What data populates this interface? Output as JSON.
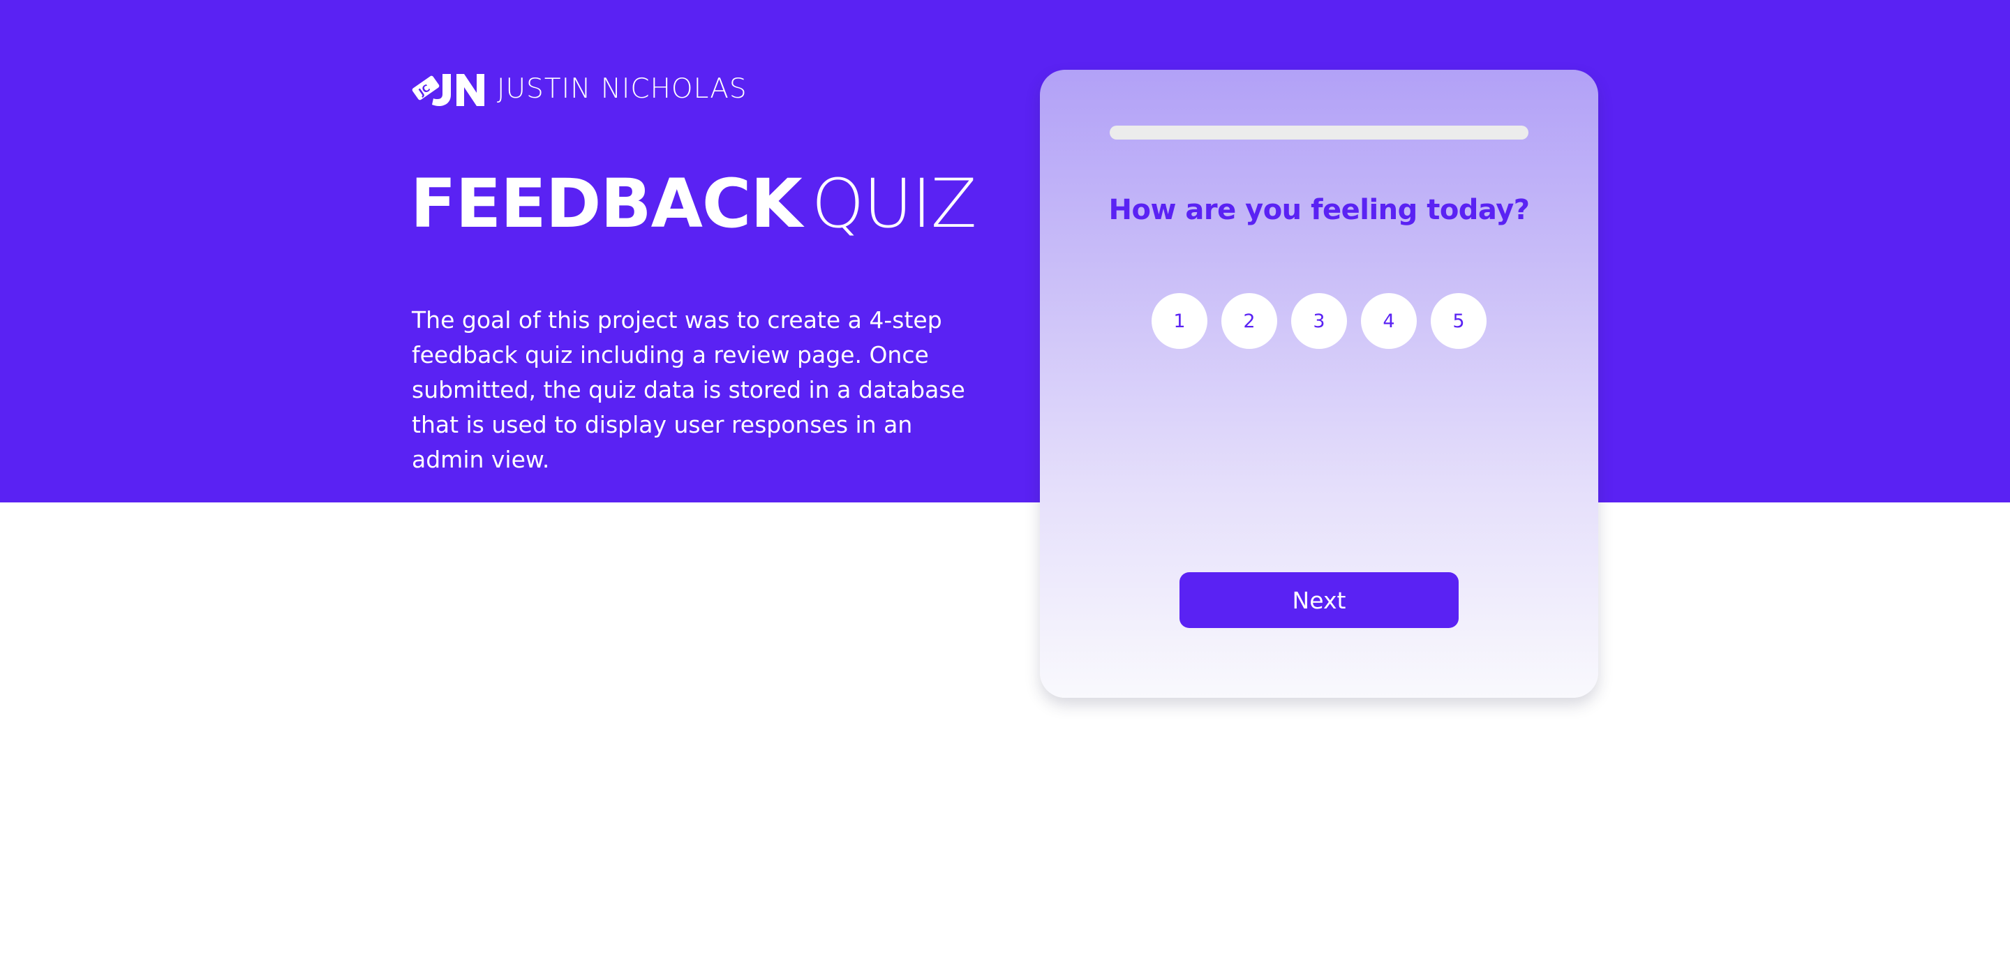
{
  "colors": {
    "brand_purple": "#5a22f3",
    "white": "#ffffff",
    "progress_track": "#ececec",
    "card_gradient_top": "#b2a1f7",
    "card_gradient_bottom": "#f9f9fd"
  },
  "brand": {
    "logo_icon": "jn-logo-icon",
    "name": "JUSTIN NICHOLAS"
  },
  "hero": {
    "title_bold": "FEEDBACK",
    "title_light": "QUIZ",
    "description": "The goal of this project was to create a 4-step feedback quiz including a review page. Once submitted, the quiz data is stored in a database that is used to display user responses in an admin view."
  },
  "quiz": {
    "progress_percent": 0,
    "question": "How are you feeling today?",
    "options": [
      "1",
      "2",
      "3",
      "4",
      "5"
    ],
    "next_label": "Next"
  }
}
